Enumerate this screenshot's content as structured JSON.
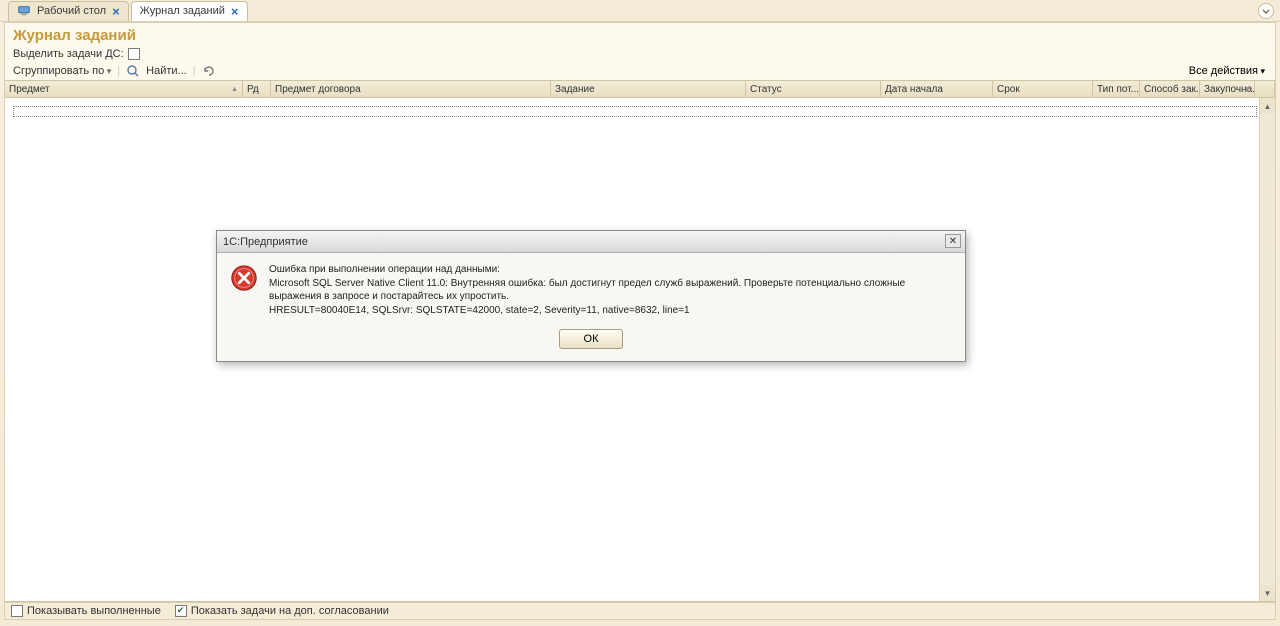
{
  "tabs": [
    {
      "label": "Рабочий стол"
    },
    {
      "label": "Журнал заданий"
    }
  ],
  "page": {
    "title": "Журнал заданий",
    "filter_label": "Выделить задачи ДС:"
  },
  "toolbar": {
    "group_by": "Сгруппировать по",
    "find": "Найти...",
    "all_actions": "Все действия"
  },
  "columns": {
    "c0": "Предмет",
    "c1": "Рд",
    "c2": "Предмет договора",
    "c3": "Задание",
    "c4": "Статус",
    "c5": "Дата начала",
    "c6": "Срок",
    "c7": "Тип пот...",
    "c8": "Способ зак...",
    "c9": "Закупочна..."
  },
  "bottom": {
    "show_done": "Показывать выполненные",
    "show_agree": "Показать задачи на доп. согласовании"
  },
  "modal": {
    "title": "1С:Предприятие",
    "line1": "Ошибка при выполнении операции над данными:",
    "line2": "Microsoft SQL Server Native Client 11.0: Внутренняя ошибка: был достигнут предел служб выражений. Проверьте потенциально сложные выражения в запросе и постарайтесь их упростить.",
    "line3": "HRESULT=80040E14, SQLSrvr: SQLSTATE=42000, state=2, Severity=11, native=8632, line=1",
    "ok": "ОК"
  }
}
